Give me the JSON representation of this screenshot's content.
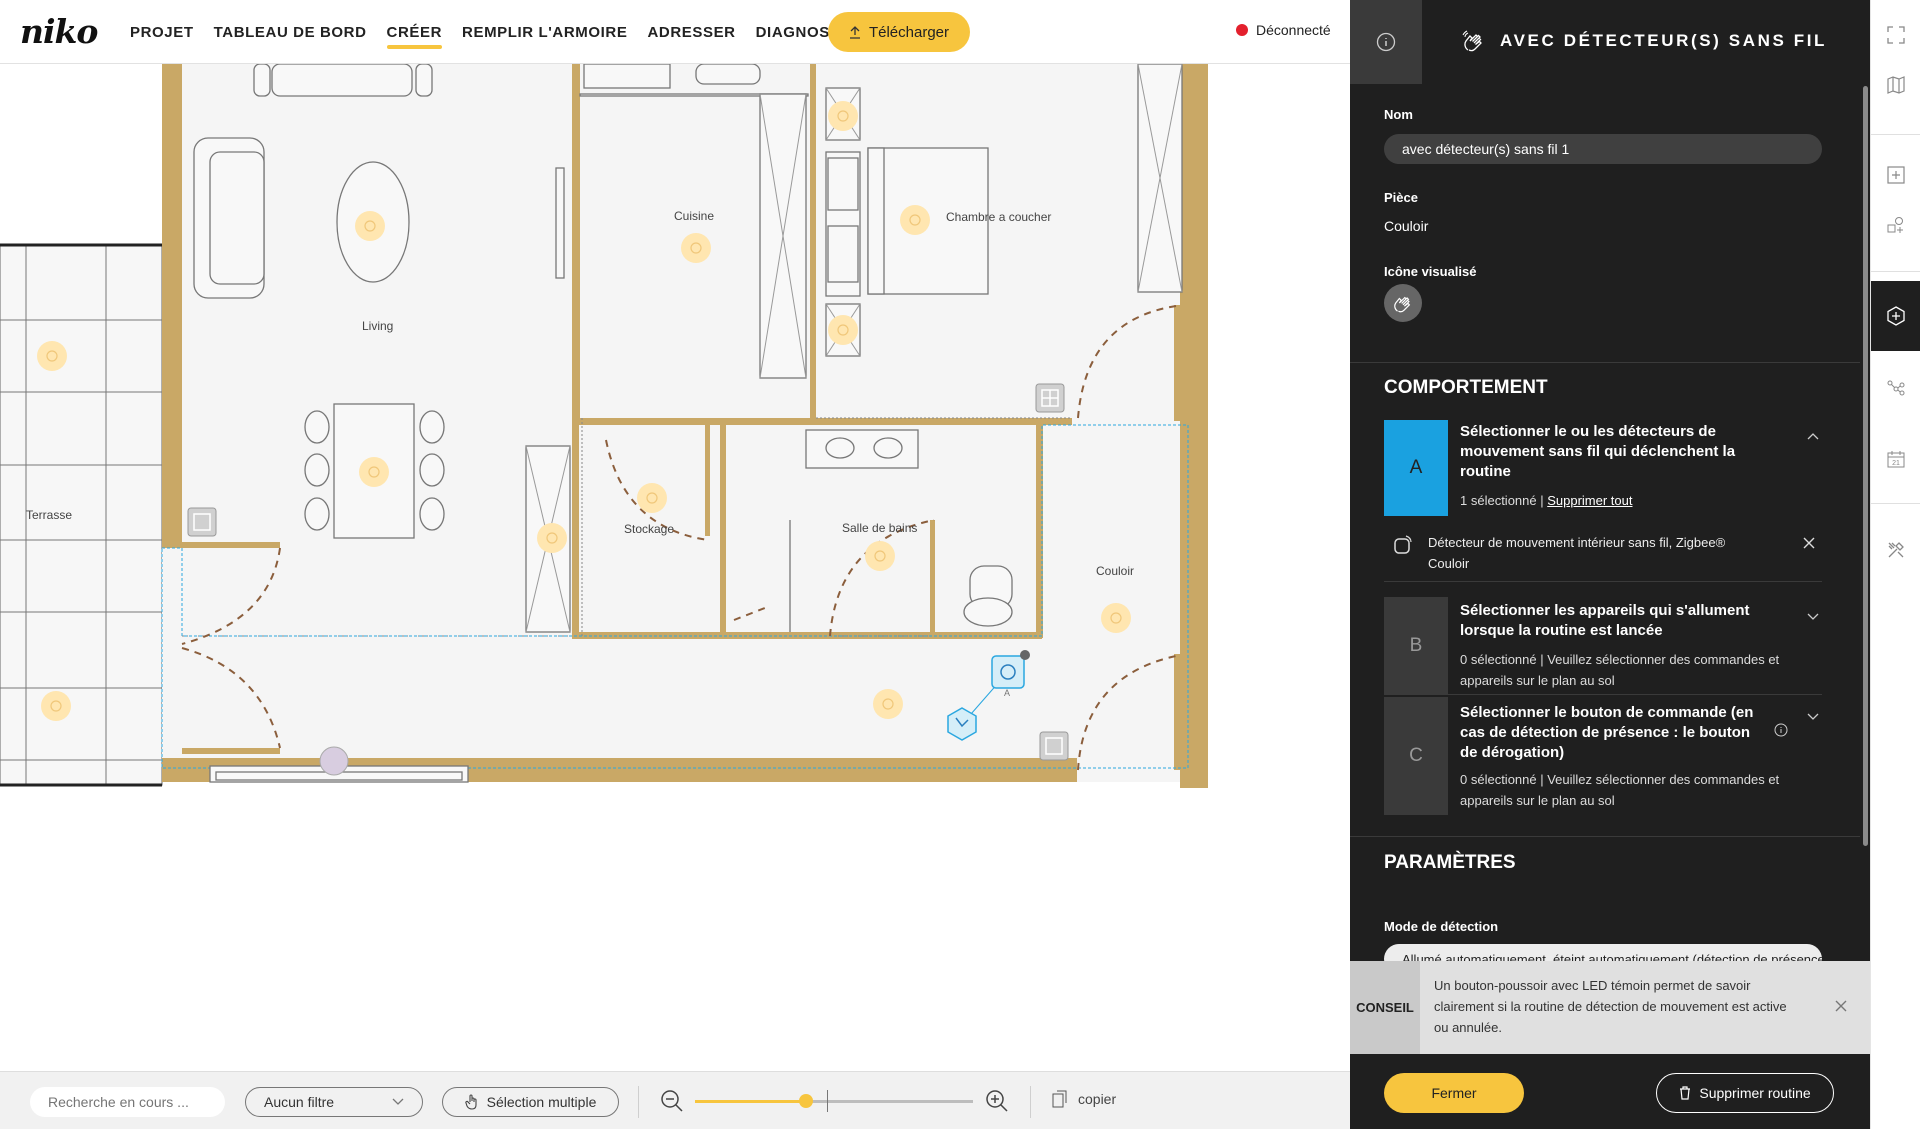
{
  "brand": {
    "logo": "niko",
    "accent": "#f7c53e"
  },
  "nav": {
    "items": [
      {
        "label": "PROJET",
        "active": false
      },
      {
        "label": "TABLEAU DE BORD",
        "active": false
      },
      {
        "label": "CRÉER",
        "active": true
      },
      {
        "label": "REMPLIR L'ARMOIRE",
        "active": false
      },
      {
        "label": "ADRESSER",
        "active": false
      },
      {
        "label": "DIAGNOSTIC",
        "active": false
      }
    ],
    "download_label": "Télécharger",
    "status_label": "Déconnecté",
    "status_color": "#e3202d"
  },
  "floorplan": {
    "rooms": [
      "Cuisine",
      "Chambre a coucher",
      "Living",
      "Terrasse",
      "Stockage",
      "Salle de bains",
      "Couloir"
    ],
    "detector_tag": "A"
  },
  "toolbar": {
    "search_placeholder": "Recherche en cours ...",
    "filter_label": "Aucun filtre",
    "multi_select_label": "Sélection multiple",
    "zoom_level": 0.4,
    "copy_label": "copier"
  },
  "panel": {
    "title": "AVEC DÉTECTEUR(S) SANS FIL",
    "name_label": "Nom",
    "name_value": "avec détecteur(s) sans fil 1",
    "room_label": "Pièce",
    "room_value": "Couloir",
    "icon_label": "Icône visualisé",
    "behaviour_title": "COMPORTEMENT",
    "steps": [
      {
        "letter": "A",
        "title": "Sélectionner le ou les détecteurs de mouvement sans fil qui déclenchent la routine",
        "sub_count": "1 sélectionné | ",
        "sub_link": "Supprimer tout",
        "color": "#1aa1e0"
      },
      {
        "letter": "B",
        "title": "Sélectionner les appareils qui s'allument lorsque la routine est lancée",
        "sub": "0 sélectionné | Veuillez sélectionner des commandes et appareils sur le plan au sol",
        "color": "#3a3a3a"
      },
      {
        "letter": "C",
        "title": "Sélectionner le bouton de commande (en cas de détection de présence : le bouton de dérogation)",
        "sub": "0 sélectionné | Veuillez sélectionner des commandes et appareils sur le plan au sol",
        "color": "#3a3a3a"
      }
    ],
    "detector": {
      "name": "Détecteur de mouvement intérieur sans fil, Zigbee®",
      "room": "Couloir"
    },
    "params_title": "PARAMÈTRES",
    "mode_label": "Mode de détection",
    "mode_value": "Allumé automatiquement, éteint automatiquement (détection de présence)",
    "tip_label": "CONSEIL",
    "tip_text": "Un bouton-poussoir avec LED témoin permet de savoir clairement si la routine de détection de mouvement est active ou annulée.",
    "close_label": "Fermer",
    "delete_label": "Supprimer routine"
  },
  "rail": {
    "icons": [
      "fullscreen-icon",
      "map-icon",
      "add-room-icon",
      "add-device-icon",
      "add-routine-icon",
      "network-icon",
      "calendar-icon",
      "tools-icon"
    ],
    "calendar_day": "21"
  }
}
